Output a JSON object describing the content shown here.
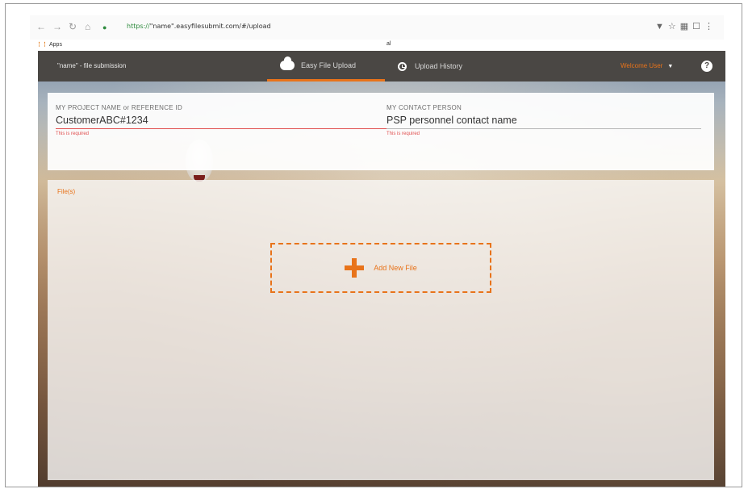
{
  "browser": {
    "url_secure": "https://",
    "url_rest": "\"name\".easyfilesubmit.com/#/upload",
    "bookmark_apps": "Apps",
    "tab_glyph": "al"
  },
  "header": {
    "app_title": "\"name\" - file submission",
    "tabs": [
      {
        "label": "Easy File Upload",
        "icon": "cloud-upload-icon",
        "active": true
      },
      {
        "label": "Upload History",
        "icon": "clock-icon",
        "active": false
      }
    ],
    "user_menu": "Welcome User",
    "help": "?"
  },
  "form": {
    "project": {
      "label": "MY PROJECT NAME or REFERENCE ID",
      "value": "CustomerABC#1234",
      "error": "This is required"
    },
    "contact": {
      "label": "MY CONTACT PERSON",
      "value": "PSP personnel contact name",
      "error": "This is required"
    }
  },
  "files": {
    "heading": "File(s)",
    "add_label": "Add New File"
  },
  "colors": {
    "accent": "#e8731a",
    "header_bg": "#4a4744",
    "error": "#e04f4f"
  }
}
